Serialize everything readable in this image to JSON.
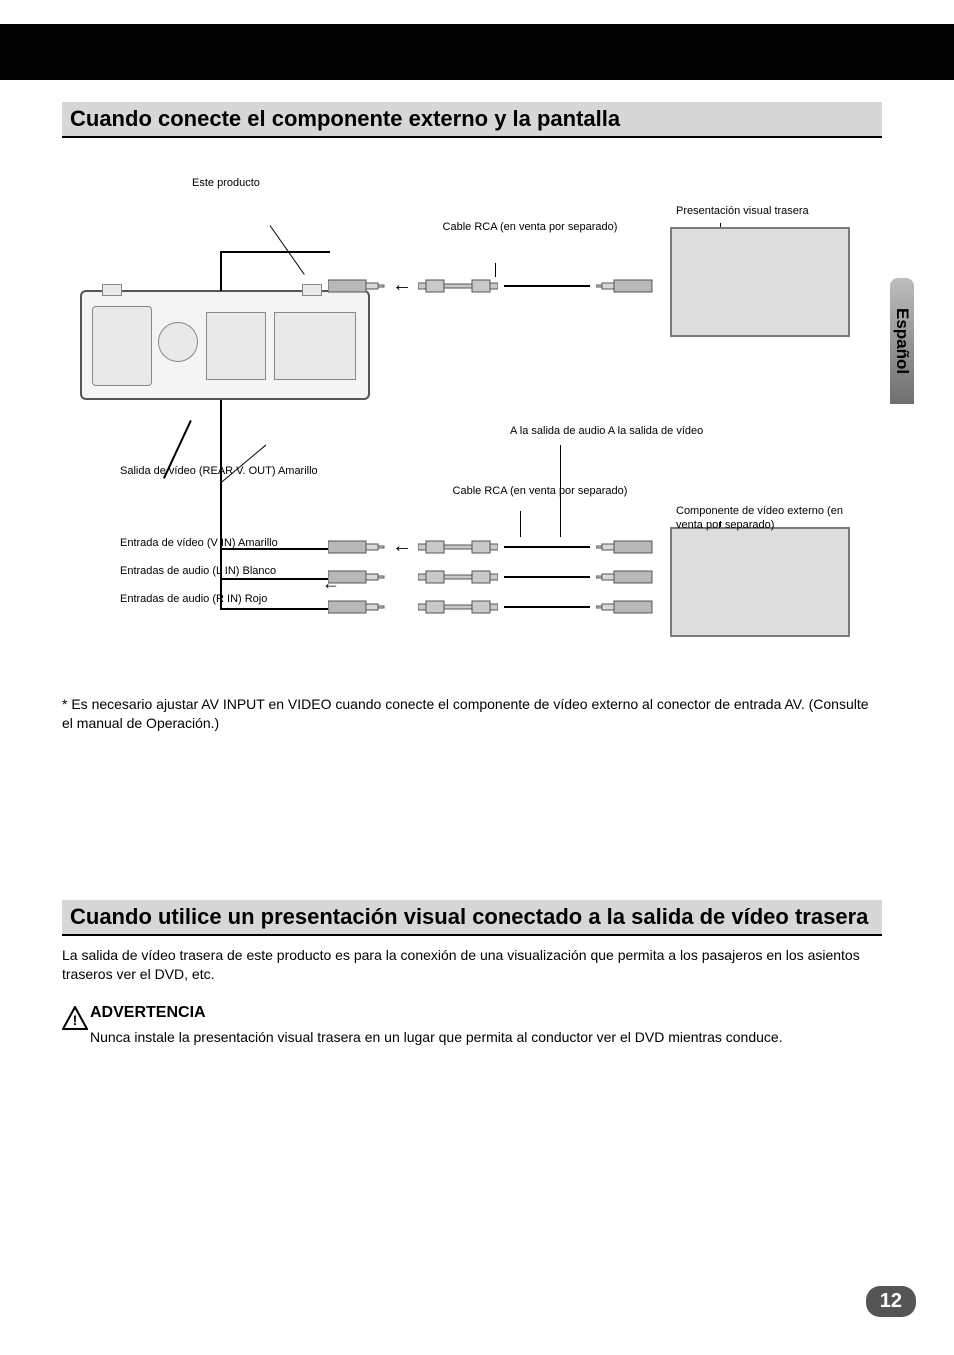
{
  "language_tab": "Español",
  "page_number": "12",
  "heading1": "Cuando conecte el componente externo y la pantalla",
  "heading2": "Cuando utilice un presentación visual conectado a la salida de vídeo trasera",
  "diagram": {
    "main_unit": "Este producto",
    "rca_cord": "Cable RCA (en venta por separado)",
    "rear_display": "Presentación visual trasera",
    "external_video": "Componente de vídeo externo (en venta por separado)",
    "v_out_label": "Salida de vídeo (REAR V. OUT) Amarillo",
    "av_in_video": "Entrada de vídeo (V IN) Amarillo",
    "av_in_audio_l": "Entradas de audio (L IN) Blanco",
    "av_in_audio_r": "Entradas de audio (R IN) Rojo",
    "audio_note": "A la salida de audio A la salida de vídeo"
  },
  "star_note": "* Es necesario ajustar AV INPUT en VIDEO cuando conecte el componente de vídeo externo al conector de entrada AV. (Consulte el manual de Operación.)",
  "below_h2_text": "La salida de vídeo trasera de este producto es para la conexión de una visualización que permita a los pasajeros en los asientos traseros ver el DVD, etc.",
  "warning": {
    "title": "ADVERTENCIA",
    "body": "Nunca instale la presentación visual trasera en un lugar que permita al conductor ver el DVD mientras conduce."
  }
}
